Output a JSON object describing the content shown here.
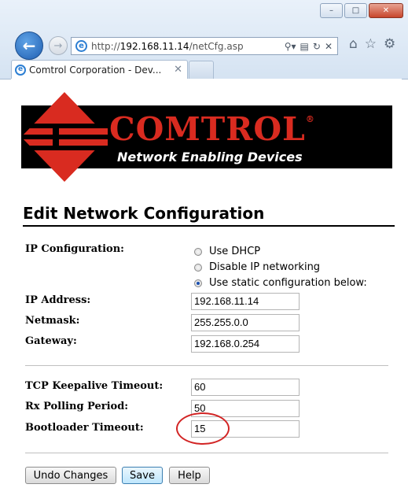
{
  "browser": {
    "url_prefix": "http://",
    "url_host": "192.168.11.14",
    "url_path": "/netCfg.asp",
    "tab_title": "Comtrol Corporation - Dev...",
    "tab_close": "✕",
    "window_buttons": {
      "minimize": "–",
      "maximize": "□",
      "close": "✕"
    },
    "icons": [
      "ie-icon",
      "back-arrow-icon",
      "forward-arrow-icon",
      "search-icon",
      "compatibility-icon",
      "refresh-icon",
      "stop-icon",
      "home-icon",
      "favorites-star-icon",
      "gear-icon"
    ]
  },
  "banner": {
    "brand": "COMTROL",
    "registered": "®",
    "tagline": "Network Enabling Devices"
  },
  "form": {
    "title": "Edit Network Configuration",
    "ip_config_label": "IP Configuration:",
    "radio_options": [
      {
        "label": "Use DHCP",
        "checked": false
      },
      {
        "label": "Disable IP networking",
        "checked": false
      },
      {
        "label": "Use static configuration below:",
        "checked": true
      }
    ],
    "ip_address_label": "IP Address:",
    "ip_address_value": "192.168.11.14",
    "netmask_label": "Netmask:",
    "netmask_value": "255.255.0.0",
    "gateway_label": "Gateway:",
    "gateway_value": "192.168.0.254",
    "tcp_keepalive_label": "TCP Keepalive Timeout:",
    "tcp_keepalive_value": "60",
    "rx_polling_label": "Rx Polling Period:",
    "rx_polling_value": "50",
    "bootloader_label": "Bootloader Timeout:",
    "bootloader_value": "15"
  },
  "buttons": {
    "undo": "Undo Changes",
    "save": "Save",
    "help": "Help"
  },
  "colors": {
    "brand_red": "#d92b20",
    "annotation_circle": "#d22424",
    "banner_bg": "#000000"
  }
}
